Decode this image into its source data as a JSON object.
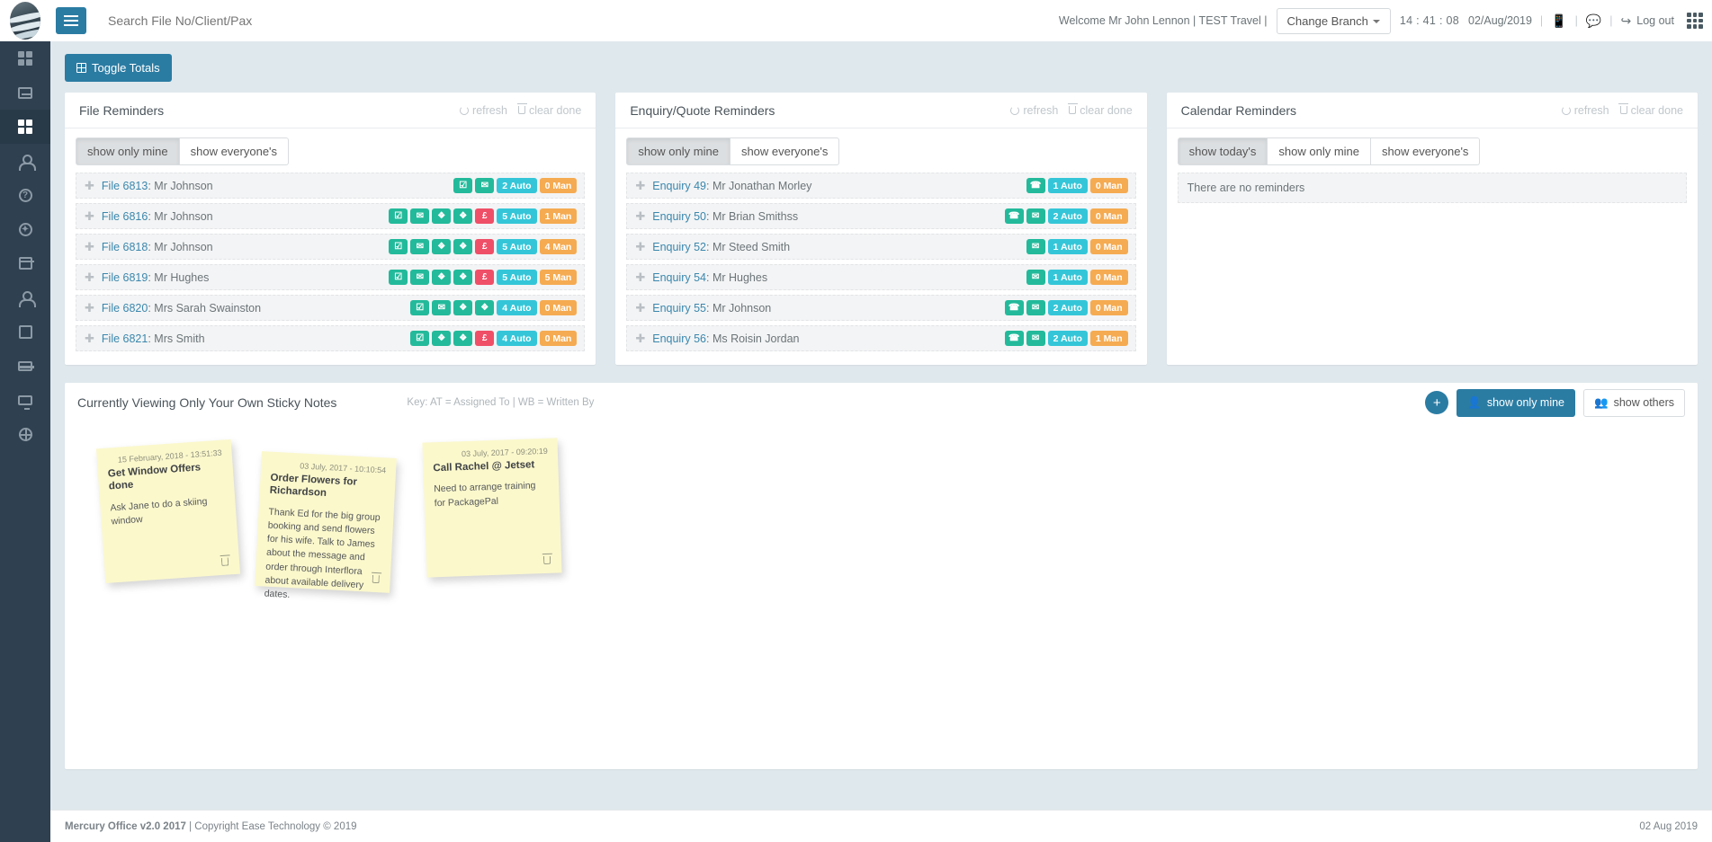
{
  "app": {
    "search_placeholder": "Search File No/Client/Pax",
    "welcome": "Welcome Mr John Lennon | TEST Travel |",
    "change_branch": "Change Branch",
    "clock": "14 : 41 : 08",
    "date": "02/Aug/2019",
    "logout": "Log out",
    "toggle_totals": "Toggle Totals"
  },
  "sidebar": {
    "items": [
      {
        "name": "dashboard-grid",
        "icon": "grid-icon"
      },
      {
        "name": "reports",
        "icon": "report-icon"
      },
      {
        "name": "home-active",
        "icon": "squares-icon"
      },
      {
        "name": "clients",
        "icon": "people-icon"
      },
      {
        "name": "help",
        "icon": "question-icon"
      },
      {
        "name": "bookings",
        "icon": "tag-icon"
      },
      {
        "name": "calendar",
        "icon": "calendar-icon"
      },
      {
        "name": "suppliers",
        "icon": "group-icon"
      },
      {
        "name": "network",
        "icon": "sitemap-icon"
      },
      {
        "name": "accounts",
        "icon": "creditcard-icon"
      },
      {
        "name": "system",
        "icon": "monitor-icon"
      },
      {
        "name": "web",
        "icon": "globe-icon"
      }
    ]
  },
  "panels": {
    "file_reminders": {
      "title": "File Reminders",
      "refresh": "refresh",
      "clear_done": "clear done",
      "filters": [
        {
          "label": "show only mine",
          "selected": true
        },
        {
          "label": "show everyone's",
          "selected": false
        }
      ],
      "rows": [
        {
          "link": "File 6813",
          "name": ": Mr Johnson",
          "badges": [
            {
              "text": "☑",
              "color": "green",
              "kind": "icon",
              "icon": "checkbox-icon"
            },
            {
              "text": "✉",
              "color": "green",
              "kind": "icon",
              "icon": "envelope-icon"
            },
            {
              "text": "2 Auto",
              "color": "cyan",
              "kind": "text"
            },
            {
              "text": "0 Man",
              "color": "orange",
              "kind": "text"
            }
          ]
        },
        {
          "link": "File 6816",
          "name": ": Mr Johnson",
          "badges": [
            {
              "text": "☑",
              "color": "green",
              "kind": "icon",
              "icon": "checkbox-icon"
            },
            {
              "text": "✉",
              "color": "green",
              "kind": "icon",
              "icon": "envelope-icon"
            },
            {
              "text": "❖",
              "color": "green",
              "kind": "icon",
              "icon": "tag-icon"
            },
            {
              "text": "❖",
              "color": "green",
              "kind": "icon",
              "icon": "tag-icon"
            },
            {
              "text": "£",
              "color": "red",
              "kind": "icon",
              "icon": "pound-icon"
            },
            {
              "text": "5 Auto",
              "color": "cyan",
              "kind": "text"
            },
            {
              "text": "1 Man",
              "color": "orange",
              "kind": "text"
            }
          ]
        },
        {
          "link": "File 6818",
          "name": ": Mr Johnson",
          "badges": [
            {
              "text": "☑",
              "color": "green",
              "kind": "icon",
              "icon": "checkbox-icon"
            },
            {
              "text": "✉",
              "color": "green",
              "kind": "icon",
              "icon": "envelope-icon"
            },
            {
              "text": "❖",
              "color": "green",
              "kind": "icon",
              "icon": "tag-icon"
            },
            {
              "text": "❖",
              "color": "green",
              "kind": "icon",
              "icon": "tag-icon"
            },
            {
              "text": "£",
              "color": "red",
              "kind": "icon",
              "icon": "pound-icon"
            },
            {
              "text": "5 Auto",
              "color": "cyan",
              "kind": "text"
            },
            {
              "text": "4 Man",
              "color": "orange",
              "kind": "text"
            }
          ]
        },
        {
          "link": "File 6819",
          "name": ": Mr Hughes",
          "badges": [
            {
              "text": "☑",
              "color": "green",
              "kind": "icon",
              "icon": "checkbox-icon"
            },
            {
              "text": "✉",
              "color": "green",
              "kind": "icon",
              "icon": "envelope-icon"
            },
            {
              "text": "❖",
              "color": "green",
              "kind": "icon",
              "icon": "tag-icon"
            },
            {
              "text": "❖",
              "color": "green",
              "kind": "icon",
              "icon": "tag-icon"
            },
            {
              "text": "£",
              "color": "red",
              "kind": "icon",
              "icon": "pound-icon"
            },
            {
              "text": "5 Auto",
              "color": "cyan",
              "kind": "text"
            },
            {
              "text": "5 Man",
              "color": "orange",
              "kind": "text"
            }
          ]
        },
        {
          "link": "File 6820",
          "name": ": Mrs Sarah Swainston",
          "badges": [
            {
              "text": "☑",
              "color": "green",
              "kind": "icon",
              "icon": "checkbox-icon"
            },
            {
              "text": "✉",
              "color": "green",
              "kind": "icon",
              "icon": "envelope-icon"
            },
            {
              "text": "❖",
              "color": "green",
              "kind": "icon",
              "icon": "tag-icon"
            },
            {
              "text": "❖",
              "color": "green",
              "kind": "icon",
              "icon": "tag-icon"
            },
            {
              "text": "4 Auto",
              "color": "cyan",
              "kind": "text"
            },
            {
              "text": "0 Man",
              "color": "orange",
              "kind": "text"
            }
          ]
        },
        {
          "link": "File 6821",
          "name": ": Mrs Smith",
          "badges": [
            {
              "text": "☑",
              "color": "green",
              "kind": "icon",
              "icon": "checkbox-icon"
            },
            {
              "text": "❖",
              "color": "green",
              "kind": "icon",
              "icon": "tag-icon"
            },
            {
              "text": "❖",
              "color": "green",
              "kind": "icon",
              "icon": "tag-icon"
            },
            {
              "text": "£",
              "color": "red",
              "kind": "icon",
              "icon": "pound-icon"
            },
            {
              "text": "4 Auto",
              "color": "cyan",
              "kind": "text"
            },
            {
              "text": "0 Man",
              "color": "orange",
              "kind": "text"
            }
          ]
        }
      ]
    },
    "enquiry_reminders": {
      "title": "Enquiry/Quote Reminders",
      "refresh": "refresh",
      "clear_done": "clear done",
      "filters": [
        {
          "label": "show only mine",
          "selected": true
        },
        {
          "label": "show everyone's",
          "selected": false
        }
      ],
      "rows": [
        {
          "link": "Enquiry 49",
          "name": ": Mr Jonathan Morley",
          "badges": [
            {
              "text": "☎",
              "color": "green",
              "kind": "icon",
              "icon": "phone-icon"
            },
            {
              "text": "1 Auto",
              "color": "cyan",
              "kind": "text"
            },
            {
              "text": "0 Man",
              "color": "orange",
              "kind": "text"
            }
          ]
        },
        {
          "link": "Enquiry 50",
          "name": ": Mr Brian Smithss",
          "badges": [
            {
              "text": "☎",
              "color": "green",
              "kind": "icon",
              "icon": "phone-icon"
            },
            {
              "text": "✉",
              "color": "green",
              "kind": "icon",
              "icon": "envelope-open-icon"
            },
            {
              "text": "2 Auto",
              "color": "cyan",
              "kind": "text"
            },
            {
              "text": "0 Man",
              "color": "orange",
              "kind": "text"
            }
          ]
        },
        {
          "link": "Enquiry 52",
          "name": ": Mr Steed Smith",
          "badges": [
            {
              "text": "✉",
              "color": "green",
              "kind": "icon",
              "icon": "envelope-open-icon"
            },
            {
              "text": "1 Auto",
              "color": "cyan",
              "kind": "text"
            },
            {
              "text": "0 Man",
              "color": "orange",
              "kind": "text"
            }
          ]
        },
        {
          "link": "Enquiry 54",
          "name": ": Mr Hughes",
          "badges": [
            {
              "text": "✉",
              "color": "green",
              "kind": "icon",
              "icon": "envelope-open-icon"
            },
            {
              "text": "1 Auto",
              "color": "cyan",
              "kind": "text"
            },
            {
              "text": "0 Man",
              "color": "orange",
              "kind": "text"
            }
          ]
        },
        {
          "link": "Enquiry 55",
          "name": ": Mr Johnson",
          "badges": [
            {
              "text": "☎",
              "color": "green",
              "kind": "icon",
              "icon": "phone-icon"
            },
            {
              "text": "✉",
              "color": "green",
              "kind": "icon",
              "icon": "envelope-open-icon"
            },
            {
              "text": "2 Auto",
              "color": "cyan",
              "kind": "text"
            },
            {
              "text": "0 Man",
              "color": "orange",
              "kind": "text"
            }
          ]
        },
        {
          "link": "Enquiry 56",
          "name": ": Ms Roisin Jordan",
          "badges": [
            {
              "text": "☎",
              "color": "green",
              "kind": "icon",
              "icon": "phone-icon"
            },
            {
              "text": "✉",
              "color": "green",
              "kind": "icon",
              "icon": "envelope-open-icon"
            },
            {
              "text": "2 Auto",
              "color": "cyan",
              "kind": "text"
            },
            {
              "text": "1 Man",
              "color": "orange",
              "kind": "text"
            }
          ]
        }
      ]
    },
    "calendar_reminders": {
      "title": "Calendar Reminders",
      "refresh": "refresh",
      "clear_done": "clear done",
      "filters": [
        {
          "label": "show today's",
          "selected": true
        },
        {
          "label": "show only mine",
          "selected": false
        },
        {
          "label": "show everyone's",
          "selected": false
        }
      ],
      "empty_text": "There are no reminders"
    }
  },
  "sticky": {
    "title": "Currently Viewing Only Your Own Sticky Notes",
    "key": "Key: AT = Assigned To | WB = Written By",
    "add_label": "+",
    "show_mine": "show only mine",
    "show_others": "show others",
    "notes": [
      {
        "date": "15 February, 2018 - 13:51:33",
        "title": "Get Window Offers done",
        "body": "Ask Jane to do a skiing window"
      },
      {
        "date": "03 July, 2017 - 10:10:54",
        "title": "Order Flowers for Richardson",
        "body": "Thank Ed for the big group booking and send flowers for his wife. Talk to James about the message and order through Interflora about available delivery dates."
      },
      {
        "date": "03 July, 2017 - 09:20:19",
        "title": "Call Rachel @ Jetset",
        "body": "Need to arrange training for PackagePal"
      }
    ]
  },
  "footer": {
    "left_bold": "Mercury Office v2.0 2017",
    "left_rest": " | Copyright Ease Technology © 2019",
    "right": "02 Aug 2019"
  },
  "colors": {
    "accent": "#2b7ca3",
    "sidebar": "#2f4050",
    "green": "#23ba9b",
    "red": "#ef4f67",
    "cyan": "#34c6d8",
    "orange": "#f5ab52"
  }
}
